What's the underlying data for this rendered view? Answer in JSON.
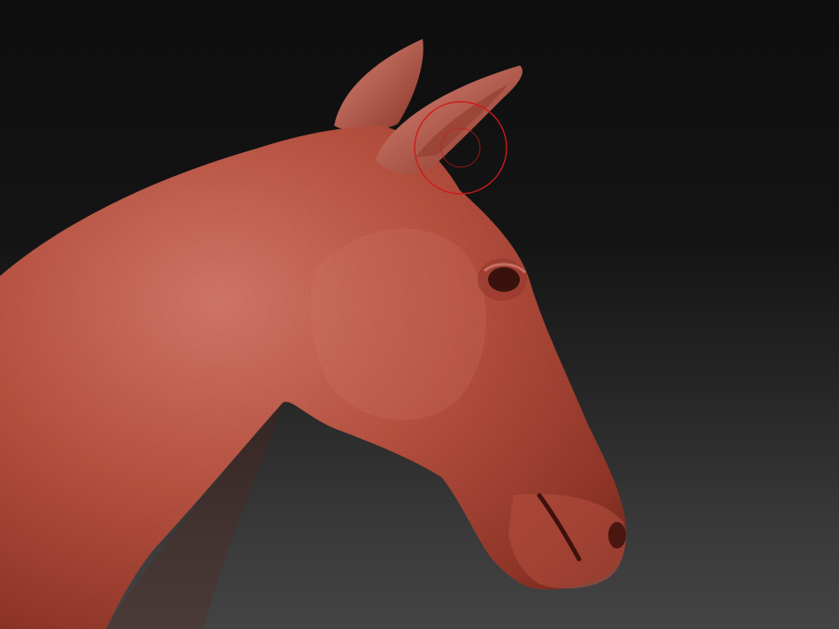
{
  "viewport": {
    "background_top": "#0e0e0e",
    "background_bottom": "#444444"
  },
  "model": {
    "subject": "horse-head-sculpt",
    "material_color": "#b5503f",
    "material_highlight": "#cf7363",
    "material_shadow": "#6a241b",
    "wireframe_mesh_visible": true
  },
  "brush_cursor": {
    "color": "#d01a1a",
    "outer_ring": true,
    "inner_ring": true
  }
}
